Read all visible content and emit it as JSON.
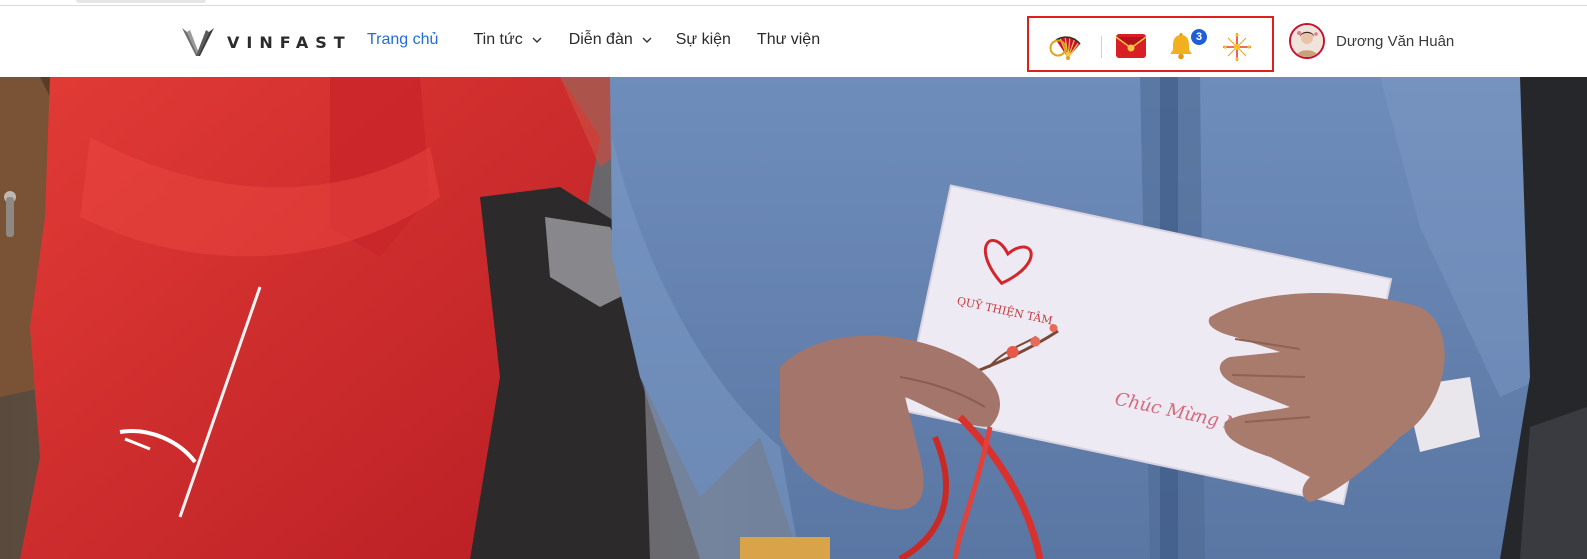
{
  "header": {
    "brand": {
      "name": "VINFAST",
      "logo_icon": "vinfast-v-logo-icon"
    },
    "nav": [
      {
        "label": "Trang chủ",
        "active": true,
        "has_dropdown": false
      },
      {
        "label": "Tin tức",
        "active": false,
        "has_dropdown": true
      },
      {
        "label": "Diễn đàn",
        "active": false,
        "has_dropdown": true
      },
      {
        "label": "Sự kiện",
        "active": false,
        "has_dropdown": false
      },
      {
        "label": "Thư viện",
        "active": false,
        "has_dropdown": false
      }
    ],
    "action_icons": {
      "fan": "paper-fan-icon",
      "envelope": "red-envelope-icon",
      "bell": "bell-icon",
      "firework": "firework-icon",
      "notification_count": "3",
      "highlight_color": "#e01e1e"
    },
    "user": {
      "name": "Dương Văn Huân",
      "avatar_icon": "user-avatar"
    }
  },
  "hero": {
    "envelope_text_top": "QUỸ THIỆN TÂM",
    "envelope_text_script": "Chúc Mừng Năm"
  },
  "colors": {
    "accent": "#1f6fd6",
    "brand_text": "#2b2b2b",
    "badge": "#1f5fd6",
    "avatar_ring": "#c8102e"
  }
}
